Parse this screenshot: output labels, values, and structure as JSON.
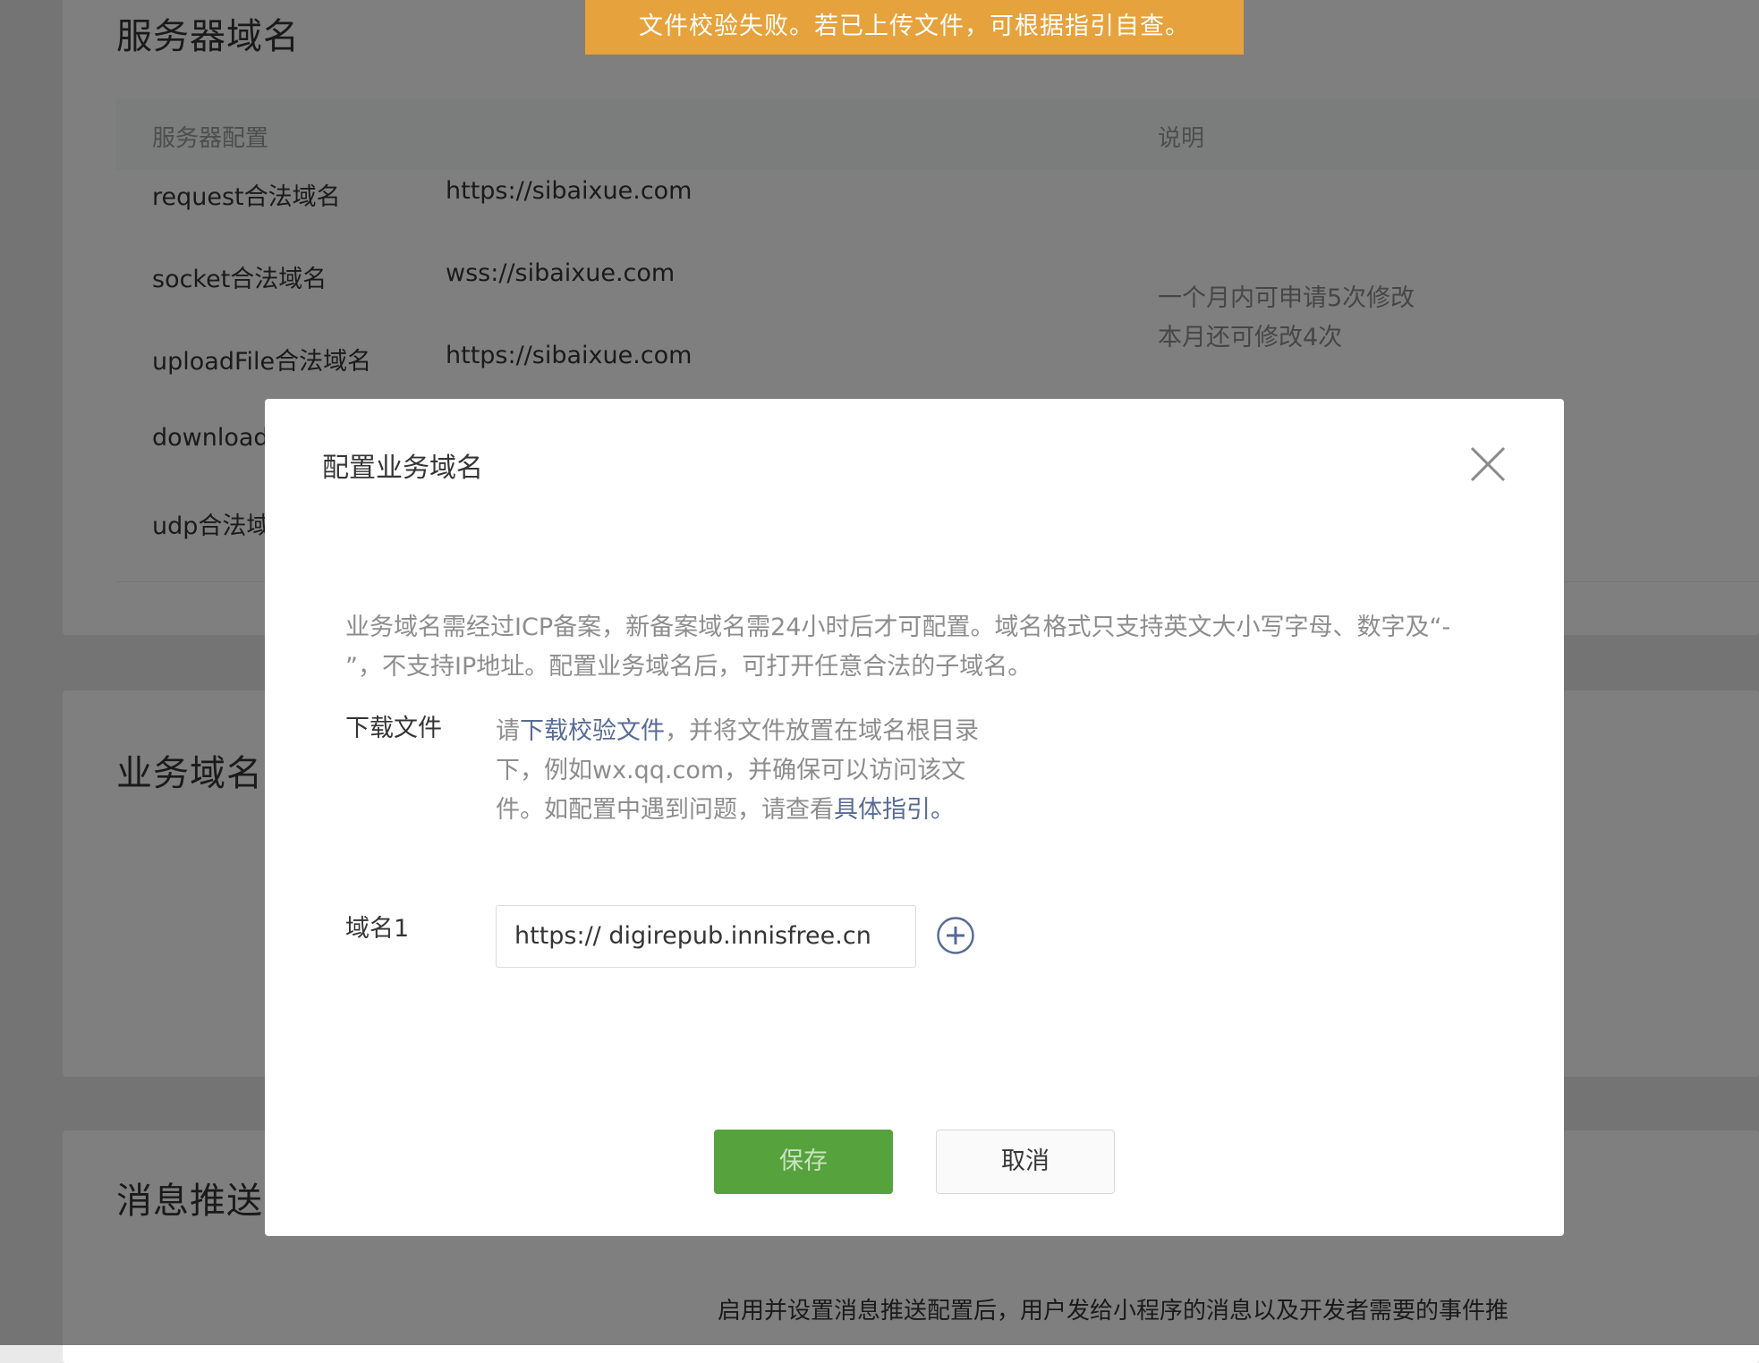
{
  "toast": {
    "text": "文件校验失败。若已上传文件，可根据指引自查。"
  },
  "server_section": {
    "title": "服务器域名",
    "header": {
      "config": "服务器配置",
      "desc": "说明"
    },
    "rows": [
      {
        "label": "request合法域名",
        "value": "https://sibaixue.com"
      },
      {
        "label": "socket合法域名",
        "value": "wss://sibaixue.com"
      },
      {
        "label": "uploadFile合法域名",
        "value": "https://sibaixue.com"
      },
      {
        "label": "download",
        "value": ""
      },
      {
        "label": "udp合法域",
        "value": ""
      }
    ],
    "note_line1": "一个月内可申请5次修改",
    "note_line2": "本月还可修改4次"
  },
  "business_section": {
    "title": "业务域名"
  },
  "message_section": {
    "title": "消息推送",
    "desc": "启用并设置消息推送配置后，用户发给小程序的消息以及开发者需要的事件推"
  },
  "dialog": {
    "title": "配置业务域名",
    "description": "业务域名需经过ICP备案，新备案域名需24小时后才可配置。域名格式只支持英文大小写字母、数字及“- ”，不支持IP地址。配置业务域名后，可打开任意合法的子域名。",
    "download": {
      "label": "下载文件",
      "text_prefix": "请",
      "link_file": "下载校验文件",
      "text_middle": "，并将文件放置在域名根目录下，例如wx.qq.com，并确保可以访问该文件。如配置中遇到问题，请查看",
      "link_guide": "具体指引。"
    },
    "domain": {
      "label": "域名1",
      "value": "https:// digirepub.innisfree.cn"
    },
    "save_label": "保存",
    "cancel_label": "取消"
  },
  "colors": {
    "toast_bg": "#e6a23c",
    "primary_green": "#56a23d",
    "link_blue": "#576b95",
    "overlay": "rgba(0,0,0,0.5)"
  },
  "icons": {
    "close": "close-icon",
    "add": "add-circle-icon"
  }
}
